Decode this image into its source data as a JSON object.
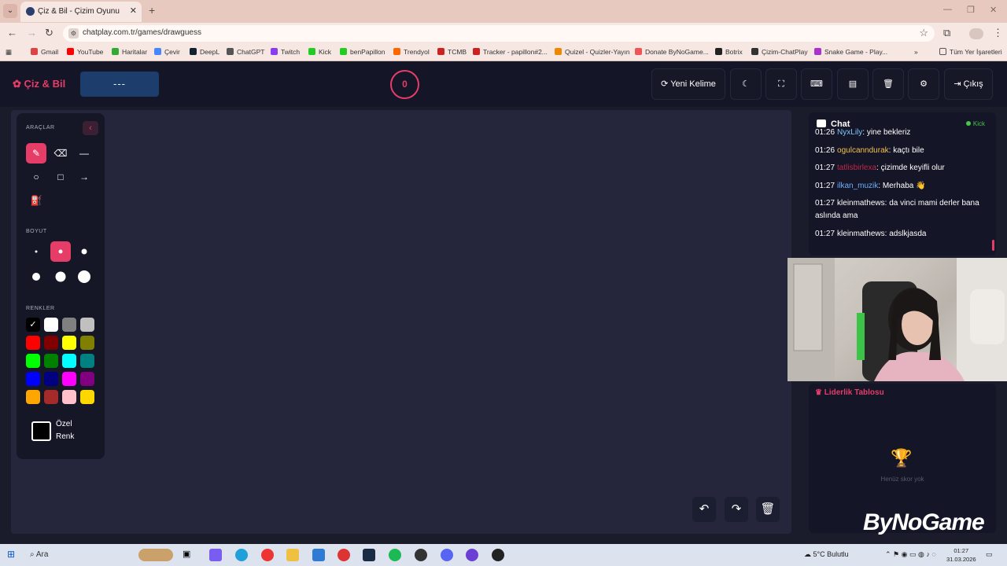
{
  "browser": {
    "tab_title": "Çiz & Bil - Çizim Oyunu",
    "url": "chatplay.com.tr/games/drawguess",
    "bookmarks": [
      "Gmail",
      "YouTube",
      "Haritalar",
      "Çevir",
      "DeepL",
      "ChatGPT",
      "Twitch",
      "Kick",
      "benPapillon",
      "Trendyol",
      "TCMB",
      "Tracker - papillon#2...",
      "Quizel - Quizler-Yayın",
      "Donate ByNoGame...",
      "Botrix",
      "Çizim-ChatPlay",
      "Snake Game - Play..."
    ],
    "all_bookmarks": "Tüm Yer İşaretleri"
  },
  "header": {
    "brand": "Çiz & Bil",
    "word": "---",
    "timer": "0",
    "new_word": "Yeni Kelime",
    "exit": "Çıkış"
  },
  "tools": {
    "tools_label": "ARAÇLAR",
    "size_label": "BOYUT",
    "colors_label": "RENKLER",
    "custom_color": "Özel Renk",
    "colors": [
      "#000000",
      "#ffffff",
      "#808080",
      "#c0c0c0",
      "#ff0000",
      "#800000",
      "#ffff00",
      "#808000",
      "#00ff00",
      "#008000",
      "#00ffff",
      "#008080",
      "#0000ff",
      "#000080",
      "#ff00ff",
      "#800080",
      "#ffa500",
      "#a52a2a",
      "#ffc0cb",
      "#ffd700"
    ]
  },
  "chat": {
    "title": "Chat",
    "platform": "Kick",
    "messages": [
      {
        "time": "01:26",
        "user": "NyxLily",
        "user_color": "#7ec8ff",
        "text": "yine bekleriz"
      },
      {
        "time": "01:26",
        "user": "ogulcanndurak",
        "user_color": "#f2c14e",
        "text": "kaçtı bile"
      },
      {
        "time": "01:27",
        "user": "tatlisbirlexa",
        "user_color": "#c0274a",
        "text": "çizimde keyifli olur"
      },
      {
        "time": "01:27",
        "user": "ilkan_muzik",
        "user_color": "#6ab0ff",
        "text": "Merhaba 👋"
      },
      {
        "time": "01:27",
        "user": "kleinmathews",
        "user_color": "#ffffff",
        "text": "da vinci mami derler bana aslında ama"
      },
      {
        "time": "01:27",
        "user": "kleinmathews",
        "user_color": "#ffffff",
        "text": "adslkjasda"
      }
    ]
  },
  "leaderboard": {
    "title": "Liderlik Tablosu",
    "empty": "Henüz skor yok"
  },
  "watermark": "ByNoGame",
  "taskbar": {
    "search": "Ara",
    "weather": "5°C  Bulutlu",
    "time": "01:27",
    "date": "31.03.2026"
  }
}
